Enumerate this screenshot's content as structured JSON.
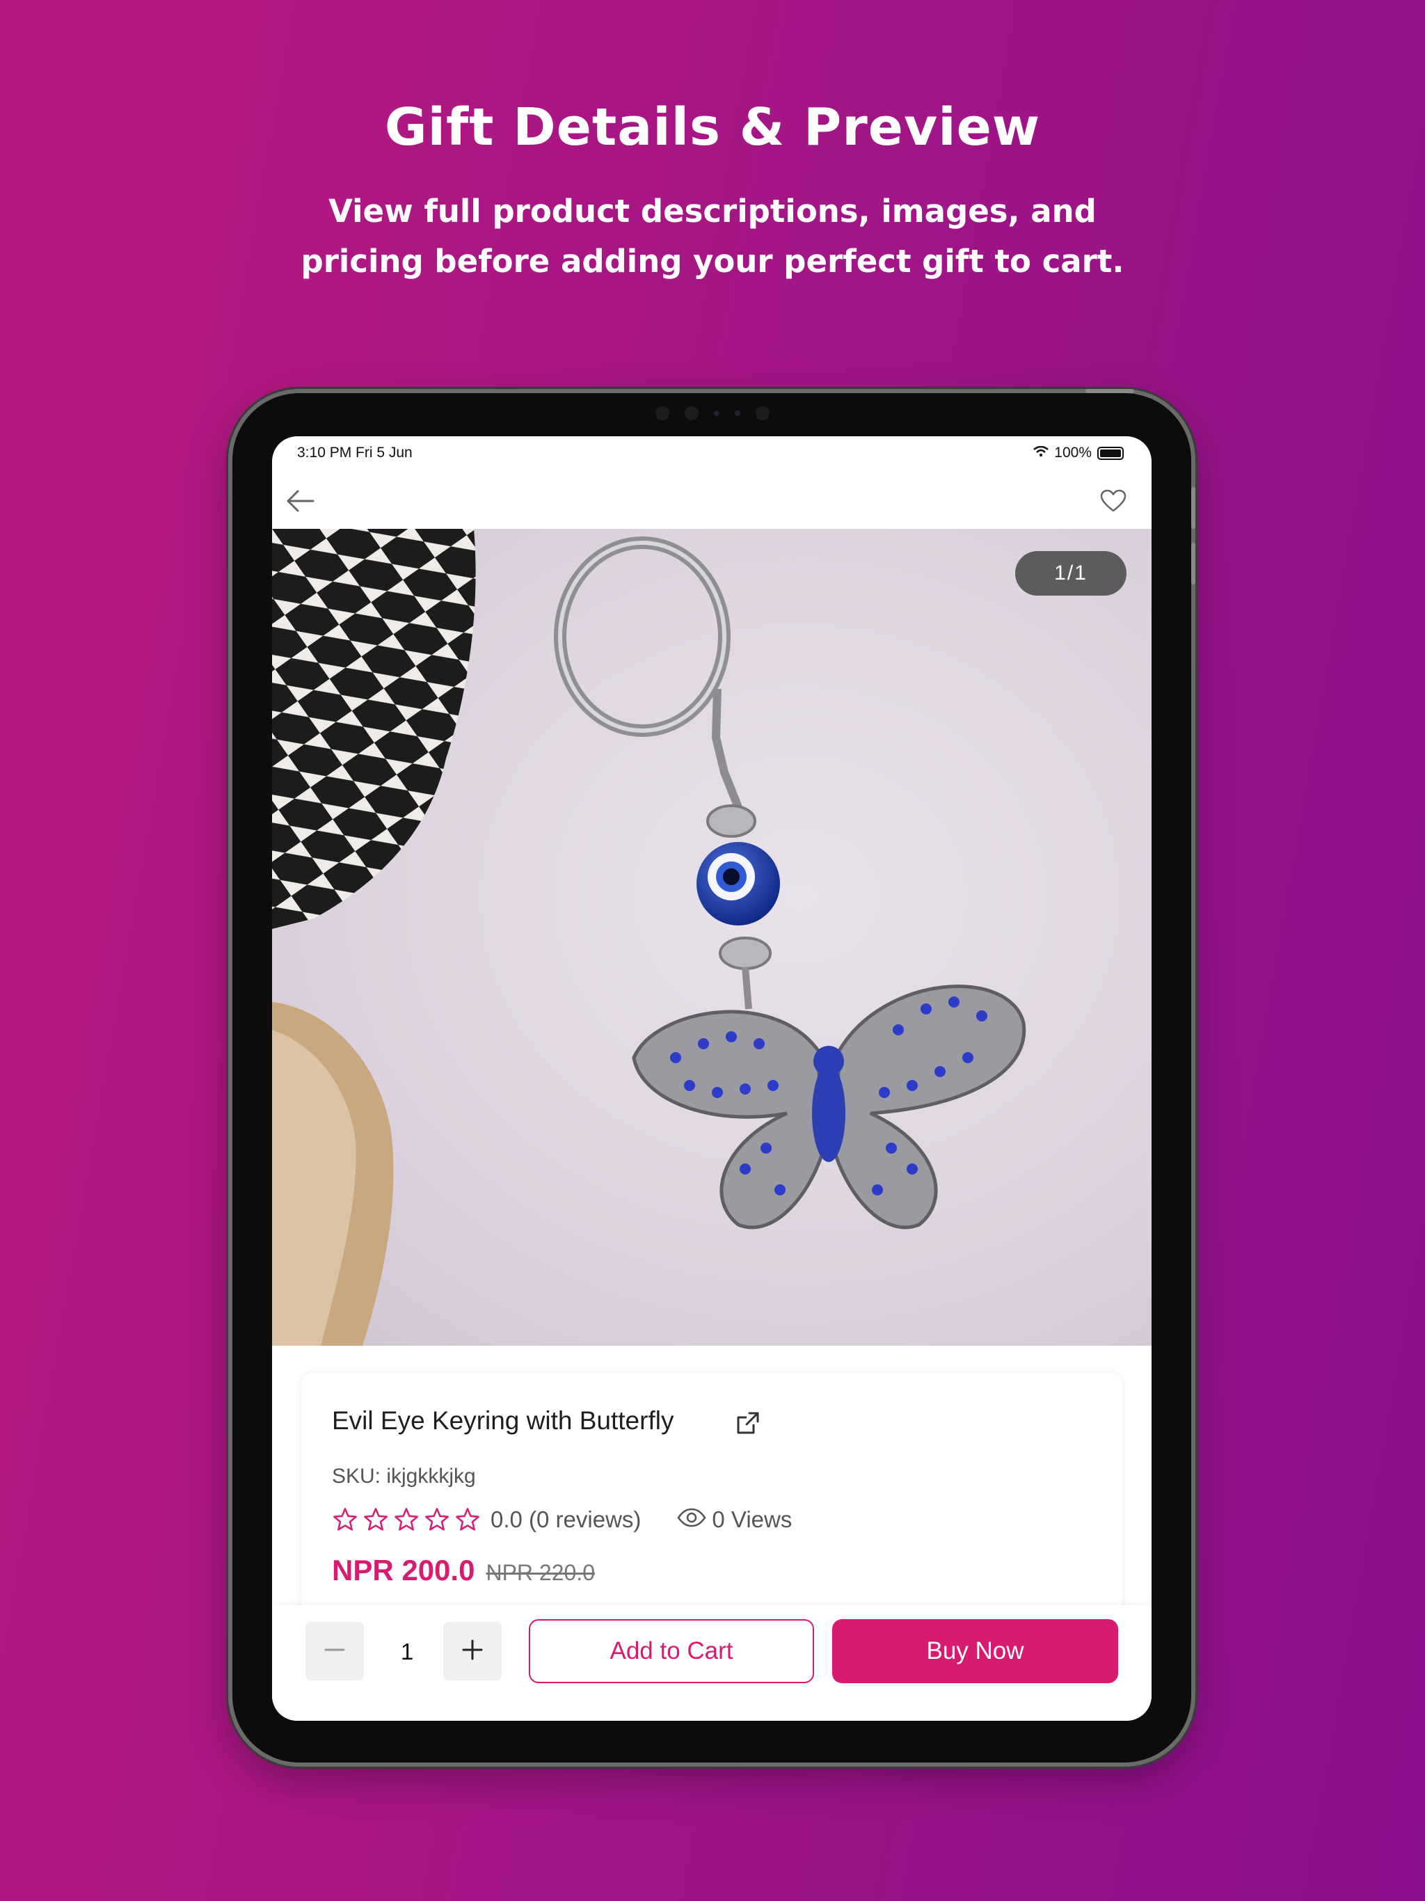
{
  "hero": {
    "title": "Gift Details & Preview",
    "subtitle_line1": "View full product descriptions, images, and",
    "subtitle_line2": "pricing before adding your perfect gift to cart."
  },
  "status_bar": {
    "time": "3:10 PM   Fri 5 Jun",
    "battery": "100%"
  },
  "nav": {
    "back_icon": "arrow-left-icon",
    "favorite_icon": "heart-outline-icon"
  },
  "gallery": {
    "counter": "1/1"
  },
  "product": {
    "title": "Evil Eye Keyring with Butterfly",
    "sku": "SKU: ikjgkkkjkg",
    "rating_text": "0.0 (0 reviews)",
    "rating_value": 0,
    "views": "0 Views",
    "price": "NPR 200.0",
    "old_price": "NPR 220.0"
  },
  "cart_bar": {
    "quantity": "1",
    "add_to_cart": "Add to Cart",
    "buy_now": "Buy Now"
  },
  "colors": {
    "accent": "#d81b6e",
    "background_start": "#b8197e",
    "background_end": "#8a0f8c"
  }
}
